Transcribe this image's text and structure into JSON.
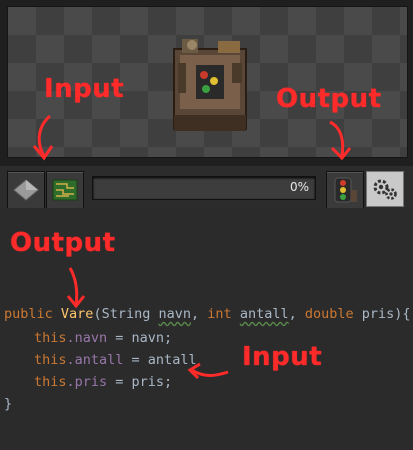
{
  "annotations": {
    "input_top": "Input",
    "output_top": "Output",
    "output_code": "Output",
    "input_code": "Input"
  },
  "progress": {
    "value": 0,
    "label": "0%"
  },
  "icons": {
    "input_slot_1": "stone-tile-icon",
    "input_slot_2": "circuit-board-icon",
    "output_slot": "traffic-signal-icon",
    "settings": "gears-icon",
    "machine": "assembling-machine-icon"
  },
  "code": {
    "signature": {
      "modifier": "public",
      "name": "Vare",
      "open": "(",
      "type1": "String",
      "param1": "navn",
      "comma1": ", ",
      "type2": "int",
      "param2": "antall",
      "comma2": ", ",
      "type3": "double",
      "param3": "pris",
      "close": "){"
    },
    "lines": [
      {
        "this": "this",
        "field": ".navn",
        "rest": " = navn;"
      },
      {
        "this": "this",
        "field": ".antall",
        "rest": " = antall"
      },
      {
        "this": "this",
        "field": ".pris",
        "rest": " = pris;"
      }
    ],
    "closing": "}"
  },
  "colors": {
    "annotation": "#ff2a2a",
    "keyword": "#cc7832",
    "method": "#ffc66d",
    "field": "#9876aa",
    "text": "#a9b7c6",
    "background": "#2b2b2b"
  }
}
